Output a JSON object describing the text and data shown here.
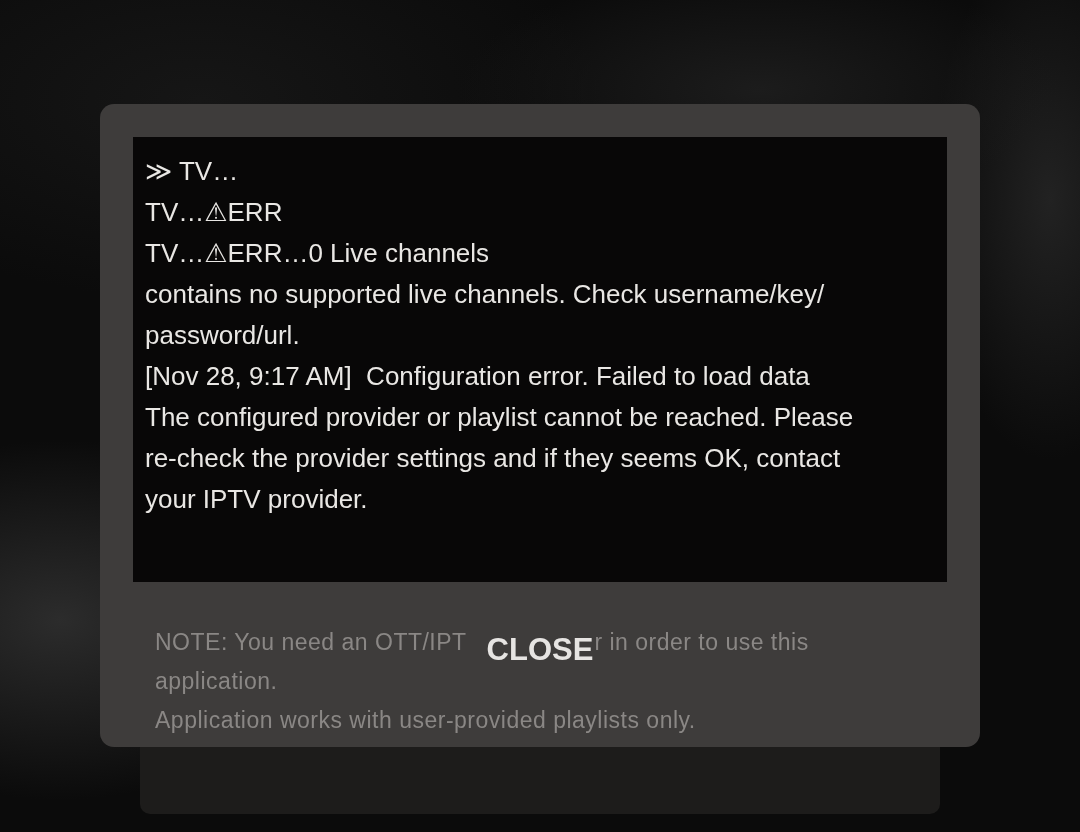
{
  "dialog": {
    "log": [
      {
        "lines": [
          "≫ TV…"
        ]
      },
      {
        "lines": [
          "TV…⚠ERR"
        ]
      },
      {
        "lines": [
          "TV…⚠ERR…0 Live channels"
        ]
      },
      {
        "lines": [
          "contains no supported live channels. Check username/key/",
          "password/url."
        ]
      },
      {
        "lines": [
          "[Nov 28, 9:17 AM]  Configuration error. Failed to load data"
        ]
      },
      {
        "lines": [
          "The configured provider or playlist cannot be reached. Please",
          "re-check the provider settings and if they seems OK, contact",
          "your IPTV provider."
        ]
      }
    ],
    "note": {
      "first_line_left": "NOTE: You need an OTT/IPT",
      "first_line_right": "r in order to use this",
      "more_lines": [
        "application.",
        "Application works with user-provided playlists only."
      ]
    },
    "close_button": {
      "label": "CLOSE"
    }
  }
}
